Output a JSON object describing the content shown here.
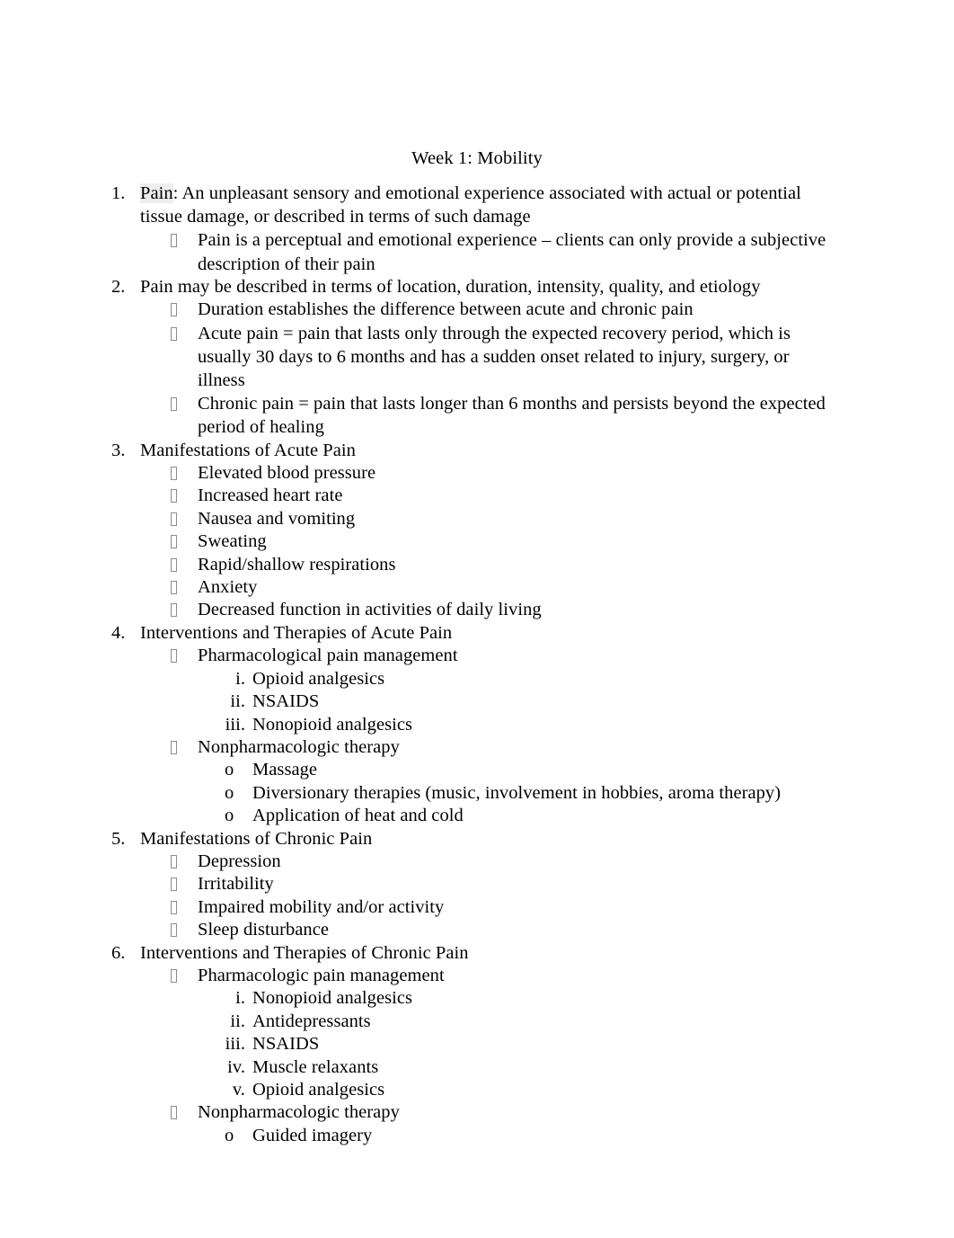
{
  "document": {
    "title": "Week 1: Mobility",
    "bullet_glyph_name": "missing-glyph-box",
    "colors": {
      "text": "#000000",
      "page_background": "#ffffff",
      "bullet_box_outline": "#8c8c8c",
      "pain_highlight": "#eeeeee"
    },
    "outline": [
      {
        "number": "1.",
        "text": "Pain: An unpleasant sensory and emotional experience associated with actual or potential tissue damage, or described in terms of such damage",
        "highlighted_word": "Pain",
        "rest": ": An unpleasant sensory and emotional experience associated with actual or potential tissue damage, or described in terms of such damage",
        "children": [
          {
            "marker": "box",
            "text": "Pain is a perceptual and emotional experience – clients can only provide a subjective description of their pain"
          }
        ]
      },
      {
        "number": "2.",
        "text": "Pain may be described in terms of location, duration, intensity, quality, and etiology",
        "children": [
          {
            "marker": "box",
            "text": "Duration establishes the difference between acute and chronic pain"
          },
          {
            "marker": "box",
            "text": "Acute pain = pain that lasts only through the expected recovery period, which is usually 30 days to 6 months and has a sudden onset related to injury, surgery, or illness"
          },
          {
            "marker": "box",
            "text": "Chronic pain = pain that lasts longer than 6 months and persists beyond the expected period of healing"
          }
        ]
      },
      {
        "number": "3.",
        "text": "Manifestations of Acute Pain",
        "children": [
          {
            "marker": "box",
            "text": "Elevated blood pressure"
          },
          {
            "marker": "box",
            "text": "Increased heart rate"
          },
          {
            "marker": "box",
            "text": "Nausea and vomiting"
          },
          {
            "marker": "box",
            "text": "Sweating"
          },
          {
            "marker": "box",
            "text": "Rapid/shallow respirations"
          },
          {
            "marker": "box",
            "text": "Anxiety"
          },
          {
            "marker": "box",
            "text": "Decreased function in activities of daily living"
          }
        ]
      },
      {
        "number": "4.",
        "text": "Interventions and Therapies of Acute Pain",
        "children": [
          {
            "marker": "box",
            "text": "Pharmacological pain management",
            "children": [
              {
                "marker": "i.",
                "text": "Opioid analgesics"
              },
              {
                "marker": "ii.",
                "text": "NSAIDS"
              },
              {
                "marker": "iii.",
                "text": "Nonopioid analgesics"
              }
            ]
          },
          {
            "marker": "box",
            "text": "Nonpharmacologic therapy",
            "children": [
              {
                "marker": "o",
                "text": "Massage"
              },
              {
                "marker": "o",
                "text": "Diversionary therapies (music, involvement in hobbies, aroma therapy)"
              },
              {
                "marker": "o",
                "text": "Application of heat and cold"
              }
            ]
          }
        ]
      },
      {
        "number": "5.",
        "text": "Manifestations of Chronic Pain",
        "children": [
          {
            "marker": "box",
            "text": "Depression"
          },
          {
            "marker": "box",
            "text": "Irritability"
          },
          {
            "marker": "box",
            "text": "Impaired mobility and/or activity"
          },
          {
            "marker": "box",
            "text": "Sleep disturbance"
          }
        ]
      },
      {
        "number": "6.",
        "text": "Interventions and Therapies of Chronic Pain",
        "children": [
          {
            "marker": "box",
            "text": "Pharmacologic pain management",
            "children": [
              {
                "marker": "i.",
                "text": "Nonopioid analgesics"
              },
              {
                "marker": "ii.",
                "text": "Antidepressants"
              },
              {
                "marker": "iii.",
                "text": "NSAIDS"
              },
              {
                "marker": "iv.",
                "text": "Muscle relaxants"
              },
              {
                "marker": "v.",
                "text": "Opioid analgesics"
              }
            ]
          },
          {
            "marker": "box",
            "text": "Nonpharmacologic therapy",
            "children": [
              {
                "marker": "o",
                "text": "Guided imagery"
              }
            ]
          }
        ]
      }
    ]
  }
}
